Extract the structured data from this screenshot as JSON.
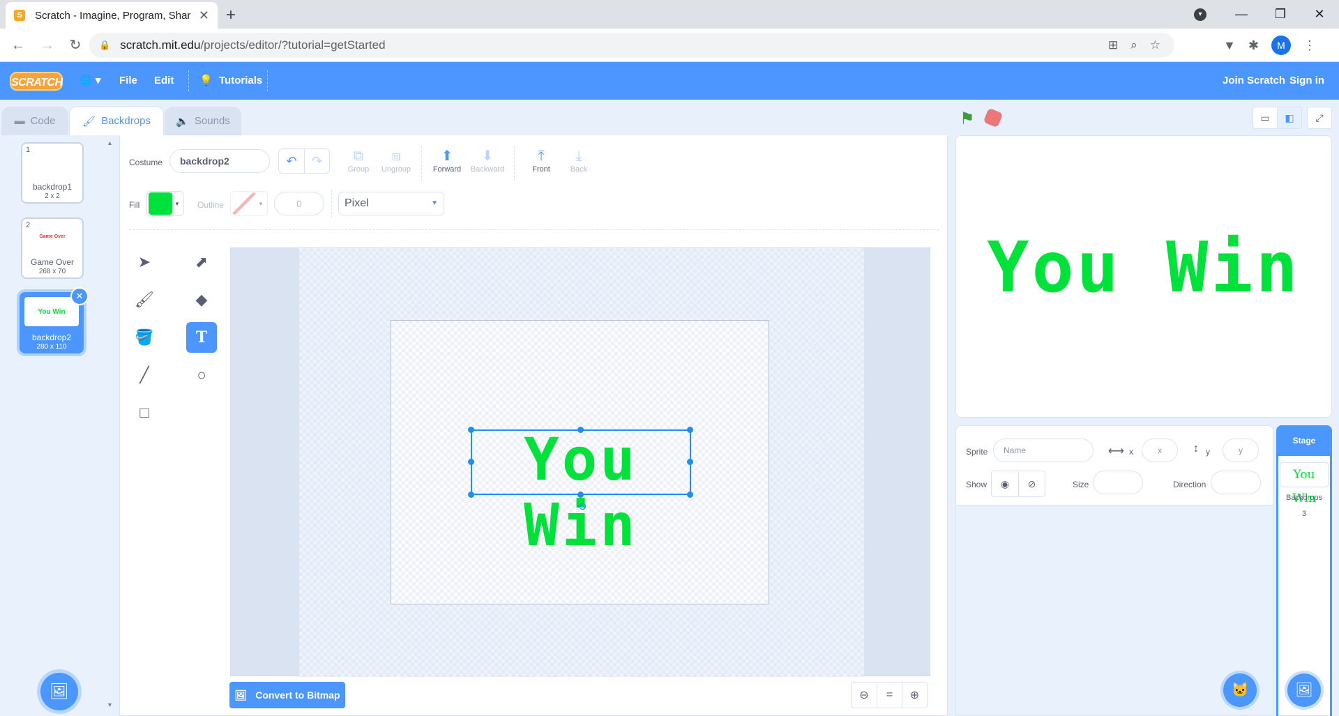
{
  "browser": {
    "tab_title": "Scratch - Imagine, Program, Shar",
    "tab_close": "✕",
    "new_tab": "+",
    "url_host": "scratch.mit.edu",
    "url_path": "/projects/editor/?tutorial=getStarted",
    "profile_initial": "M",
    "win_min": "—",
    "win_restore": "❐",
    "win_close": "✕"
  },
  "menubar": {
    "logo": "SCRATCH",
    "globe": "🌐 ▾",
    "file": "File",
    "edit": "Edit",
    "tutorials": "Tutorials",
    "join": "Join Scratch",
    "signin": "Sign in"
  },
  "tabs": {
    "code": "Code",
    "backdrops": "Backdrops",
    "sounds": "Sounds"
  },
  "costumes": [
    {
      "num": "1",
      "name": "backdrop1",
      "size": "2 x 2",
      "thumb": ""
    },
    {
      "num": "2",
      "name": "Game Over",
      "size": "268 x 70",
      "thumb": "Game Over"
    },
    {
      "num": "3",
      "name": "backdrop2",
      "size": "280 x 110",
      "thumb": "You Win"
    }
  ],
  "paint": {
    "costume_label": "Costume",
    "costume_name": "backdrop2",
    "group": "Group",
    "ungroup": "Ungroup",
    "forward": "Forward",
    "backward": "Backward",
    "front": "Front",
    "back": "Back",
    "fill_label": "Fill",
    "fill_color": "#00e23b",
    "outline_label": "Outline",
    "outline_width": "0",
    "font_mode": "Pixel",
    "canvas_text": "You Win",
    "convert": "Convert to Bitmap",
    "zoom_reset": "="
  },
  "stage": {
    "text": "You Win",
    "text_color": "#00e23b"
  },
  "sprite_info": {
    "sprite_label": "Sprite",
    "name_placeholder": "Name",
    "x_label": "x",
    "x_placeholder": "x",
    "y_label": "y",
    "y_placeholder": "y",
    "show_label": "Show",
    "size_label": "Size",
    "direction_label": "Direction"
  },
  "stage_pane": {
    "header": "Stage",
    "thumb_text": "You Win",
    "backdrops_label": "Backdrops",
    "backdrops_count": "3"
  }
}
